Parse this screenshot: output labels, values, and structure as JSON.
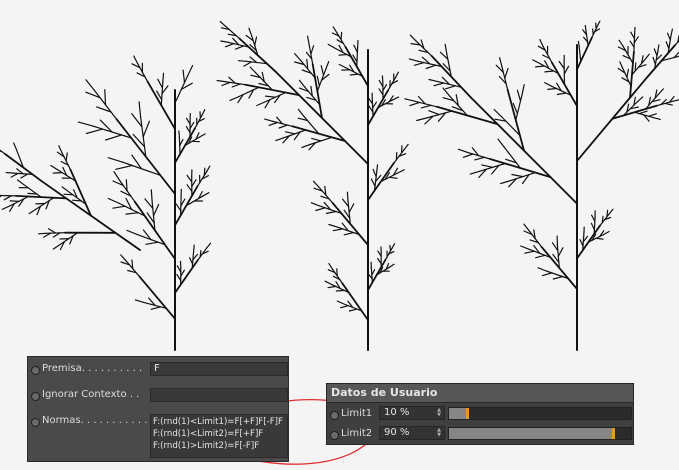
{
  "trees": {
    "stroke_color": "#111111",
    "count": 3
  },
  "attributes": {
    "premisa": {
      "label": "Premisa. . . . . . . . . .",
      "value": "F"
    },
    "ignorar": {
      "label": "Ignorar Contexto  . .",
      "value": ""
    },
    "normas": {
      "label": "Normas. . . . . . . . . . .",
      "rules": [
        "F:(rnd(1)<Limit1)=F[+F]F[-F]F",
        "F:(rnd(1)<Limit2)=F[+F]F",
        "F:(rnd(1)>Limit2)=F[-F]F"
      ]
    }
  },
  "user_data": {
    "title": "Datos de Usuario",
    "params": [
      {
        "label": "Limit1",
        "value": "10 %",
        "fraction": 0.1
      },
      {
        "label": "Limit2",
        "value": "90 %",
        "fraction": 0.9
      }
    ]
  },
  "colors": {
    "arrow": "#e03030",
    "slider_handle": "#e89a1c",
    "panel_bg": "#4a4a4a"
  }
}
